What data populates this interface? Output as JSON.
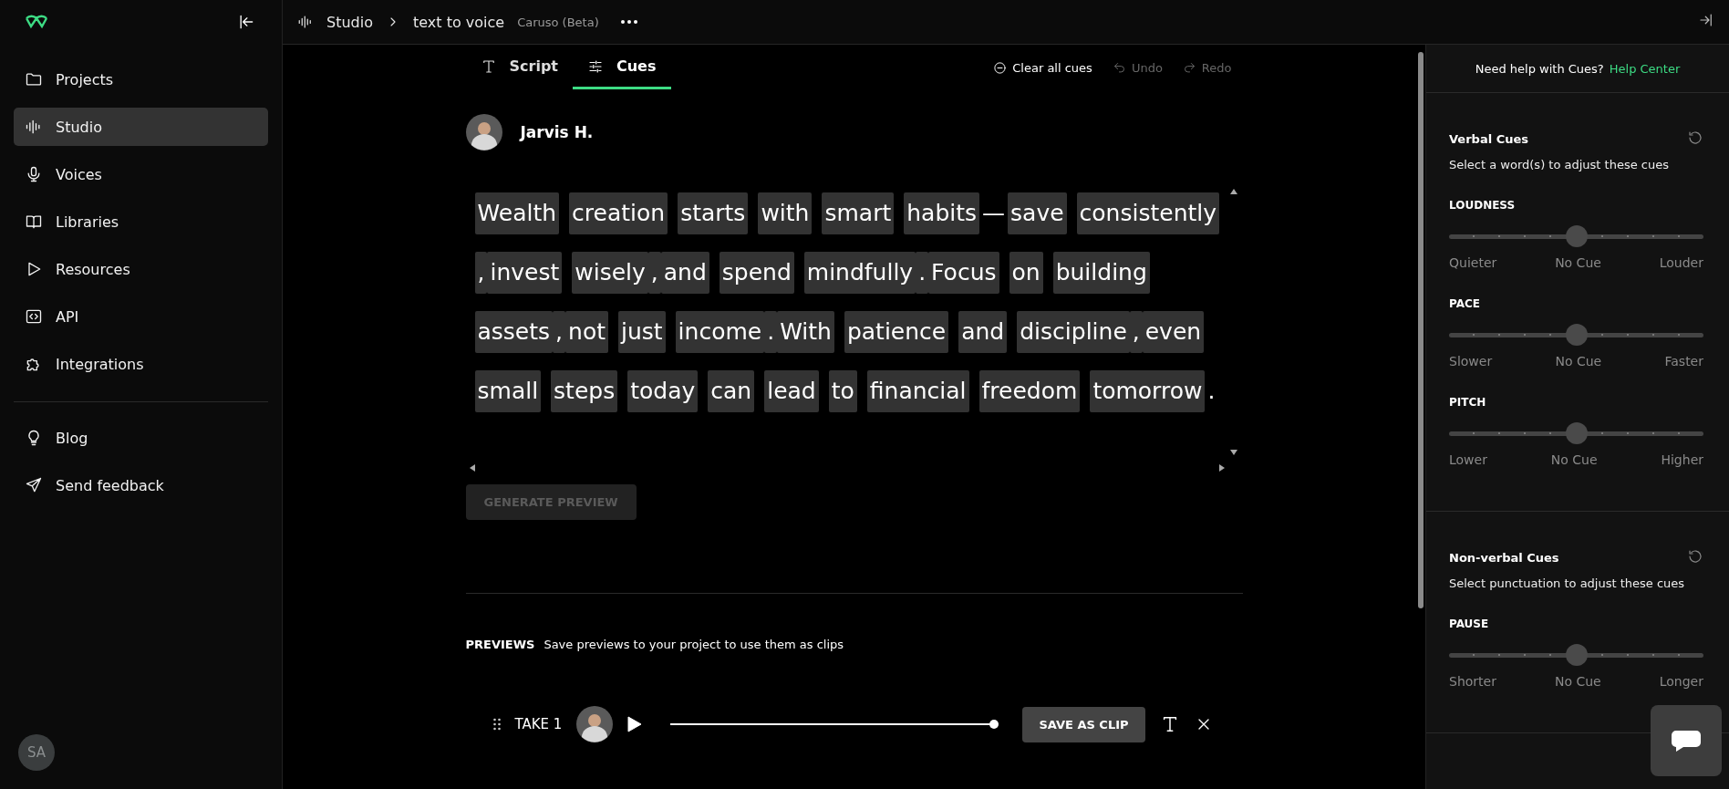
{
  "sidebar": {
    "items": [
      {
        "label": "Projects",
        "selected": false
      },
      {
        "label": "Studio",
        "selected": true
      },
      {
        "label": "Voices",
        "selected": false
      },
      {
        "label": "Libraries",
        "selected": false
      },
      {
        "label": "Resources",
        "selected": false
      },
      {
        "label": "API",
        "selected": false
      },
      {
        "label": "Integrations",
        "selected": false
      }
    ],
    "secondary_items": [
      {
        "label": "Blog"
      },
      {
        "label": "Send feedback"
      }
    ],
    "user_initials": "SA"
  },
  "breadcrumb": {
    "items": [
      "Studio",
      "text to voice"
    ],
    "model": "Caruso (Beta)"
  },
  "tabs": [
    {
      "label": "Script",
      "selected": false
    },
    {
      "label": "Cues",
      "selected": true
    }
  ],
  "actions": [
    {
      "label": "Clear all cues",
      "disabled": false
    },
    {
      "label": "Undo",
      "disabled": true
    },
    {
      "label": "Redo",
      "disabled": true
    }
  ],
  "voice": {
    "name": "Jarvis H."
  },
  "script_lines": [
    [
      {
        "text": "Wealth",
        "kind": "word"
      },
      {
        "text": "creation",
        "kind": "word"
      },
      {
        "text": "starts",
        "kind": "word"
      },
      {
        "text": "with",
        "kind": "word"
      },
      {
        "text": "smart",
        "kind": "word"
      },
      {
        "text": "habits",
        "kind": "word"
      },
      {
        "text": "—",
        "kind": "mark"
      },
      {
        "text": "save",
        "kind": "word"
      },
      {
        "text": "consistently",
        "kind": "word"
      }
    ],
    [
      {
        "text": ",",
        "kind": "punct"
      },
      {
        "text": "invest",
        "kind": "word"
      },
      {
        "text": "wisely",
        "kind": "word"
      },
      {
        "text": ",",
        "kind": "punct"
      },
      {
        "text": "and",
        "kind": "word"
      },
      {
        "text": "spend",
        "kind": "word"
      },
      {
        "text": "mindfully",
        "kind": "word"
      },
      {
        "text": ".",
        "kind": "punct"
      },
      {
        "text": "Focus",
        "kind": "word"
      },
      {
        "text": "on",
        "kind": "word"
      },
      {
        "text": "building",
        "kind": "word"
      }
    ],
    [
      {
        "text": "assets",
        "kind": "word"
      },
      {
        "text": ",",
        "kind": "punct"
      },
      {
        "text": "not",
        "kind": "word"
      },
      {
        "text": "just",
        "kind": "word"
      },
      {
        "text": "income",
        "kind": "word"
      },
      {
        "text": ".",
        "kind": "punct"
      },
      {
        "text": "With",
        "kind": "word"
      },
      {
        "text": "patience",
        "kind": "word"
      },
      {
        "text": "and",
        "kind": "word"
      },
      {
        "text": "discipline",
        "kind": "word"
      },
      {
        "text": ",",
        "kind": "punct"
      },
      {
        "text": "even",
        "kind": "word"
      }
    ],
    [
      {
        "text": "small",
        "kind": "word"
      },
      {
        "text": "steps",
        "kind": "word"
      },
      {
        "text": "today",
        "kind": "word"
      },
      {
        "text": "can",
        "kind": "word"
      },
      {
        "text": "lead",
        "kind": "word"
      },
      {
        "text": "to",
        "kind": "word"
      },
      {
        "text": "financial",
        "kind": "word"
      },
      {
        "text": "freedom",
        "kind": "word"
      },
      {
        "text": "tomorrow",
        "kind": "word"
      },
      {
        "text": ".",
        "kind": "mark"
      }
    ]
  ],
  "generate_button": {
    "label": "GENERATE PREVIEW",
    "disabled": true
  },
  "previews": {
    "title": "PREVIEWS",
    "hint": "Save previews to your project to use them as clips",
    "takes": [
      {
        "label": "TAKE 1",
        "level": 1,
        "save_label": "SAVE AS CLIP"
      }
    ]
  },
  "help": {
    "text": "Need help with Cues?",
    "link": "Help Center"
  },
  "cue_sections": [
    {
      "title": "Verbal Cues",
      "hint": "Select a word(s) to adjust these cues",
      "sliders": [
        {
          "label": "LOUDNESS",
          "level": 0.5,
          "low": "Quieter",
          "mid": "No Cue",
          "high": "Louder"
        },
        {
          "label": "PACE",
          "level": 0.5,
          "low": "Slower",
          "mid": "No Cue",
          "high": "Faster"
        },
        {
          "label": "PITCH",
          "level": 0.5,
          "low": "Lower",
          "mid": "No Cue",
          "high": "Higher"
        }
      ]
    },
    {
      "title": "Non-verbal Cues",
      "hint": "Select punctuation to adjust these cues",
      "sliders": [
        {
          "label": "PAUSE",
          "level": 0.5,
          "low": "Shorter",
          "mid": "No Cue",
          "high": "Longer"
        }
      ]
    }
  ]
}
